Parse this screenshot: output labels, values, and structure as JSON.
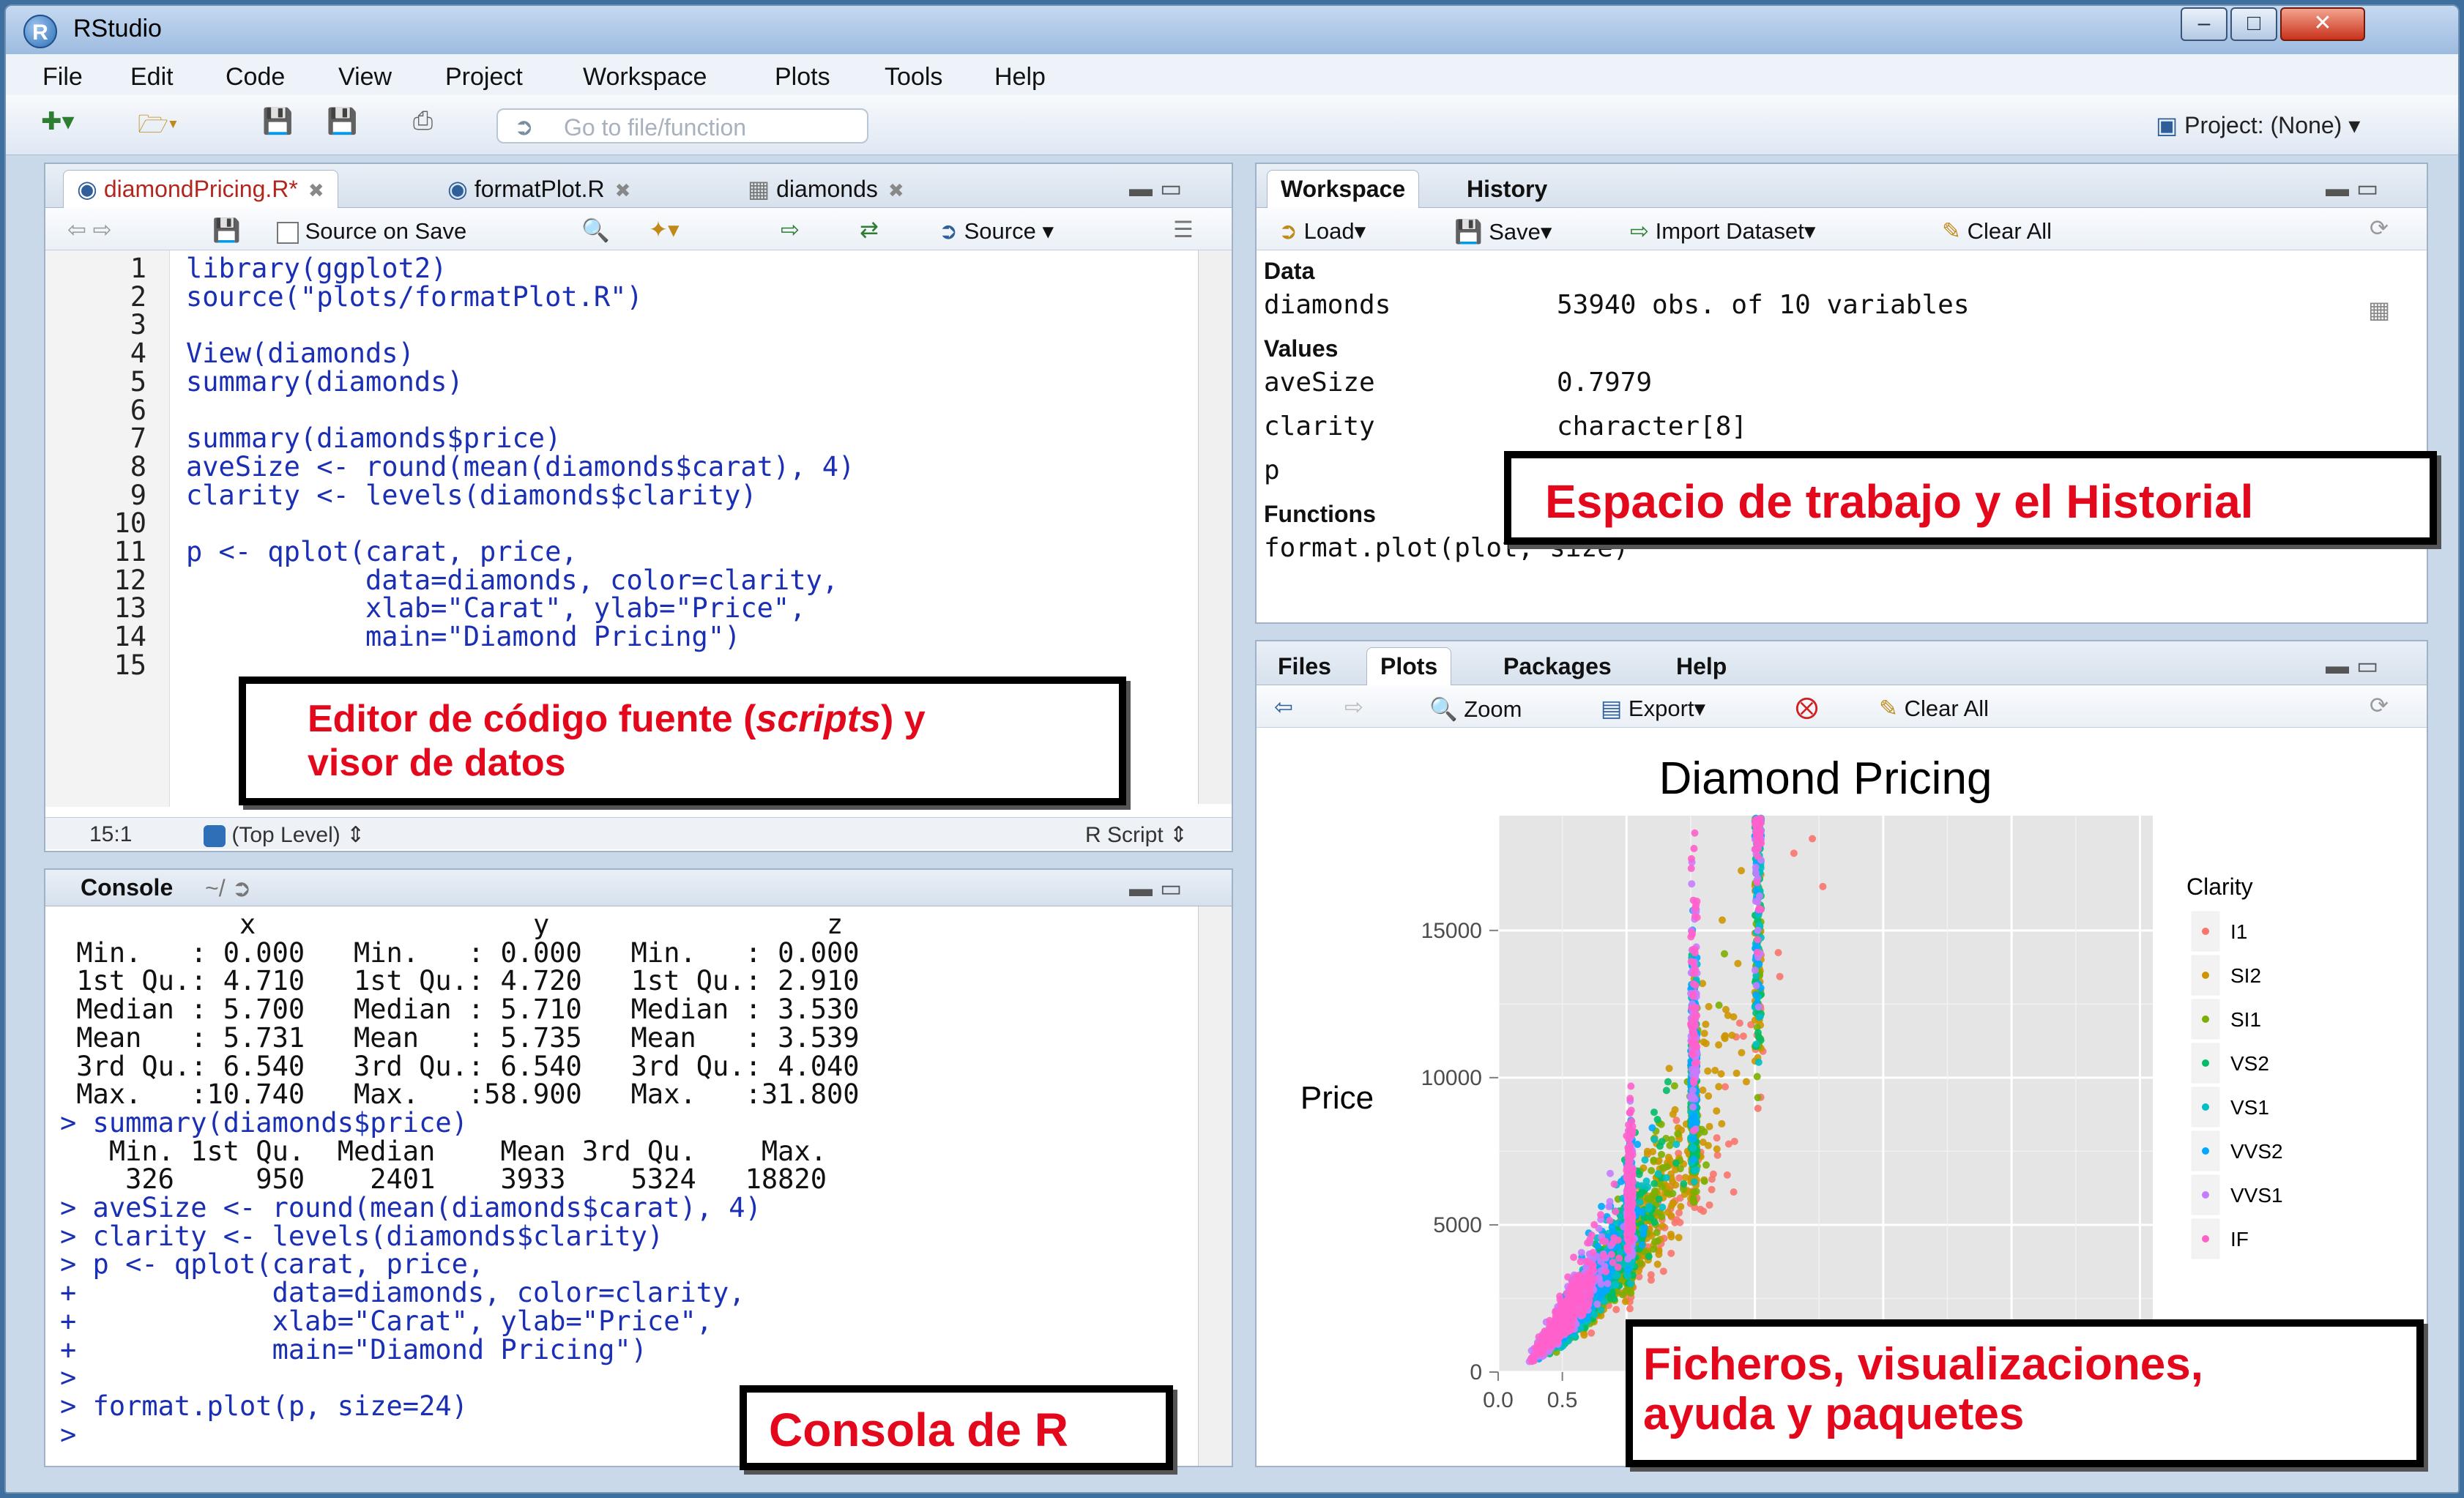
{
  "window": {
    "title": "RStudio",
    "logo": "R"
  },
  "menubar": [
    "File",
    "Edit",
    "Code",
    "View",
    "Project",
    "Workspace",
    "Plots",
    "Tools",
    "Help"
  ],
  "toolbar": {
    "go_to_file_placeholder": "Go to file/function",
    "project": "Project: (None)"
  },
  "editor": {
    "tabs": [
      {
        "label": "diamondPricing.R*",
        "active": true
      },
      {
        "label": "formatPlot.R",
        "active": false
      },
      {
        "label": "diamonds",
        "active": false
      }
    ],
    "source_on_save": "Source on Save",
    "source_button": "Source",
    "lines": [
      "library(ggplot2)",
      "source(\"plots/formatPlot.R\")",
      "",
      "View(diamonds)",
      "summary(diamonds)",
      "",
      "summary(diamonds$price)",
      "aveSize <- round(mean(diamonds$carat), 4)",
      "clarity <- levels(diamonds$clarity)",
      "",
      "p <- qplot(carat, price,",
      "           data=diamonds, color=clarity,",
      "           xlab=\"Carat\", ylab=\"Price\",",
      "           main=\"Diamond Pricing\")",
      ""
    ],
    "line_numbers": [
      "1",
      "2",
      "3",
      "4",
      "5",
      "6",
      "7",
      "8",
      "9",
      "10",
      "11",
      "12",
      "13",
      "14",
      "15"
    ],
    "status_position": "15:1",
    "status_scope": "(Top Level)",
    "status_type": "R Script"
  },
  "callouts": {
    "editor_line1_a": "Editor de código fuente (",
    "editor_line1_em": "scripts",
    "editor_line1_b": ") y",
    "editor_line2": "visor de datos",
    "workspace": "Espacio de trabajo y el Historial",
    "console": "Consola de R",
    "files_line1": "Ficheros, visualizaciones,",
    "files_line2": "ayuda y paquetes"
  },
  "console": {
    "title": "Console",
    "path": "~/",
    "lines": [
      "           x                 y                 z",
      " Min.   : 0.000   Min.   : 0.000   Min.   : 0.000",
      " 1st Qu.: 4.710   1st Qu.: 4.720   1st Qu.: 2.910",
      " Median : 5.700   Median : 5.710   Median : 3.530",
      " Mean   : 5.731   Mean   : 5.735   Mean   : 3.539",
      " 3rd Qu.: 6.540   3rd Qu.: 6.540   3rd Qu.: 4.040",
      " Max.   :10.740   Max.   :58.900   Max.   :31.800",
      "> summary(diamonds$price)",
      "   Min. 1st Qu.  Median    Mean 3rd Qu.    Max.",
      "    326     950    2401    3933    5324   18820",
      "> aveSize <- round(mean(diamonds$carat), 4)",
      "> clarity <- levels(diamonds$clarity)",
      "> p <- qplot(carat, price,",
      "+            data=diamonds, color=clarity,",
      "+            xlab=\"Carat\", ylab=\"Price\",",
      "+            main=\"Diamond Pricing\")",
      ">",
      "> format.plot(p, size=24)",
      "> "
    ]
  },
  "workspace": {
    "tabs": [
      {
        "label": "Workspace",
        "active": true
      },
      {
        "label": "History",
        "active": false
      }
    ],
    "toolbar": {
      "load": "Load",
      "save": "Save",
      "import": "Import Dataset",
      "clear": "Clear All"
    },
    "sections": {
      "data": "Data",
      "values": "Values",
      "functions": "Functions"
    },
    "data_rows": [
      {
        "name": "diamonds",
        "value": "53940 obs. of 10 variables"
      }
    ],
    "value_rows": [
      {
        "name": "aveSize",
        "value": "0.7979"
      },
      {
        "name": "clarity",
        "value": "character[8]"
      },
      {
        "name": "p",
        "value": ""
      }
    ],
    "function_rows": [
      {
        "name": "format.plot(plot, size)"
      }
    ]
  },
  "files": {
    "tabs": [
      {
        "label": "Files",
        "active": false
      },
      {
        "label": "Plots",
        "active": true
      },
      {
        "label": "Packages",
        "active": false
      },
      {
        "label": "Help",
        "active": false
      }
    ],
    "toolbar": {
      "zoom": "Zoom",
      "export": "Export",
      "clear": "Clear All"
    }
  },
  "chart_data": {
    "type": "scatter",
    "title": "Diamond Pricing",
    "xlabel": "Carat",
    "ylabel": "Price",
    "xlim": [
      0,
      5.1
    ],
    "ylim": [
      0,
      18900
    ],
    "xticks": [
      "0.0",
      "0.5"
    ],
    "yticks": [
      0,
      5000,
      10000,
      15000
    ],
    "ytick_labels": [
      "0",
      "5000",
      "10000",
      "15000"
    ],
    "grid": true,
    "legend": {
      "title": "Clarity",
      "position": "right"
    },
    "series": [
      {
        "name": "I1",
        "color": "#f8766d"
      },
      {
        "name": "SI2",
        "color": "#cd9600"
      },
      {
        "name": "SI1",
        "color": "#7cae00"
      },
      {
        "name": "VS2",
        "color": "#00be67"
      },
      {
        "name": "VS1",
        "color": "#00bfc4"
      },
      {
        "name": "VVS2",
        "color": "#00a9ff"
      },
      {
        "name": "VVS1",
        "color": "#c77cff"
      },
      {
        "name": "IF",
        "color": "#ff61cc"
      }
    ]
  }
}
